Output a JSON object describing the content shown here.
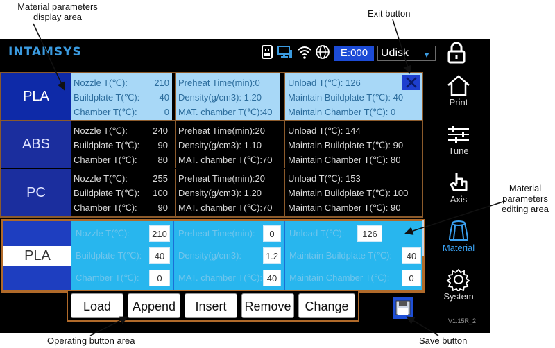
{
  "annotations": {
    "display_area": "Material parameters display area",
    "exit_button": "Exit button",
    "editing_area": "Material parameters editing area",
    "operating_area": "Operating button area",
    "save_button": "Save button"
  },
  "header": {
    "brand": "INTAMSYS",
    "error_code": "E:000",
    "storage": "Udisk"
  },
  "materials": [
    {
      "name": "PLA",
      "nozzle_label": "Nozzle T(℃):",
      "nozzle": "210",
      "buildplate_label": "Buildplate T(℃):",
      "buildplate": "40",
      "chamber_label": "Chamber T(℃):",
      "chamber": "0",
      "preheat_label": "Preheat Time(min):",
      "preheat": "0",
      "density_label": "Density(g/cm3):",
      "density": "1.20",
      "mat_chamber_label": "MAT. chamber T(℃):",
      "mat_chamber": "40",
      "unload_label": "Unload T(℃):",
      "unload": "126",
      "maint_buildplate_label": "Maintain Buildplate T(℃):",
      "maint_buildplate": "40",
      "maint_chamber_label": "Maintain Chamber T(℃):",
      "maint_chamber": "0"
    },
    {
      "name": "ABS",
      "nozzle_label": "Nozzle T(℃):",
      "nozzle": "240",
      "buildplate_label": "Buildplate T(℃):",
      "buildplate": "90",
      "chamber_label": "Chamber T(℃):",
      "chamber": "80",
      "preheat_label": "Preheat Time(min):",
      "preheat": "20",
      "density_label": "Density(g/cm3):",
      "density": "1.10",
      "mat_chamber_label": "MAT. chamber T(℃):",
      "mat_chamber": "70",
      "unload_label": "Unload T(℃):",
      "unload": "144",
      "maint_buildplate_label": "Maintain Buildplate T(℃):",
      "maint_buildplate": "90",
      "maint_chamber_label": "Maintain Chamber T(℃):",
      "maint_chamber": "80"
    },
    {
      "name": "PC",
      "nozzle_label": "Nozzle T(℃):",
      "nozzle": "255",
      "buildplate_label": "Buildplate T(℃):",
      "buildplate": "100",
      "chamber_label": "Chamber T(℃):",
      "chamber": "90",
      "preheat_label": "Preheat Time(min):",
      "preheat": "20",
      "density_label": "Density(g/cm3):",
      "density": "1.20",
      "mat_chamber_label": "MAT. chamber T(℃):",
      "mat_chamber": "70",
      "unload_label": "Unload T(℃):",
      "unload": "153",
      "maint_buildplate_label": "Maintain Buildplate T(℃):",
      "maint_buildplate": "100",
      "maint_chamber_label": "Maintain Chamber T(℃):",
      "maint_chamber": "90"
    }
  ],
  "editor": {
    "name": "PLA",
    "nozzle_label": "Nozzle T(℃):",
    "nozzle": "210",
    "buildplate_label": "Buildplate T(℃):",
    "buildplate": "40",
    "chamber_label": "Chamber T(℃):",
    "chamber": "0",
    "preheat_label": "Preheat Time(min):",
    "preheat": "0",
    "density_label": "Density(g/cm3):",
    "density": "1.2",
    "mat_chamber_label": "MAT. chamber T(℃):",
    "mat_chamber": "40",
    "unload_label": "Unload T(℃):",
    "unload": "126",
    "maint_buildplate_label": "Maintain Buildplate T(℃):",
    "maint_buildplate": "40",
    "maint_chamber_label": "Maintain Chamber T(℃):",
    "maint_chamber": "0"
  },
  "operations": {
    "load": "Load",
    "append": "Append",
    "insert": "Insert",
    "remove": "Remove",
    "change": "Change"
  },
  "nav": {
    "print": "Print",
    "tune": "Tune",
    "axis": "Axis",
    "material": "Material",
    "system": "System"
  },
  "version": "V1.15R_2",
  "icons": {
    "usb": "usb-icon",
    "monitor": "monitor-icon",
    "wifi": "wifi-icon",
    "globe": "globe-icon",
    "lock": "lock-icon",
    "exit": "close-icon",
    "save": "floppy-disk-icon",
    "print": "home-icon",
    "tune": "sliders-icon",
    "axis": "hand-pointer-icon",
    "material": "filament-icon",
    "system": "gear-icon"
  },
  "colors": {
    "brand": "#3b9be0",
    "accent_blue": "#1e3fcf",
    "selected_row": "#a8d8f7",
    "editor_cyan": "#28b6ee",
    "frame_brown": "#8b5a2b",
    "material_nav": "#3aa0f0"
  }
}
